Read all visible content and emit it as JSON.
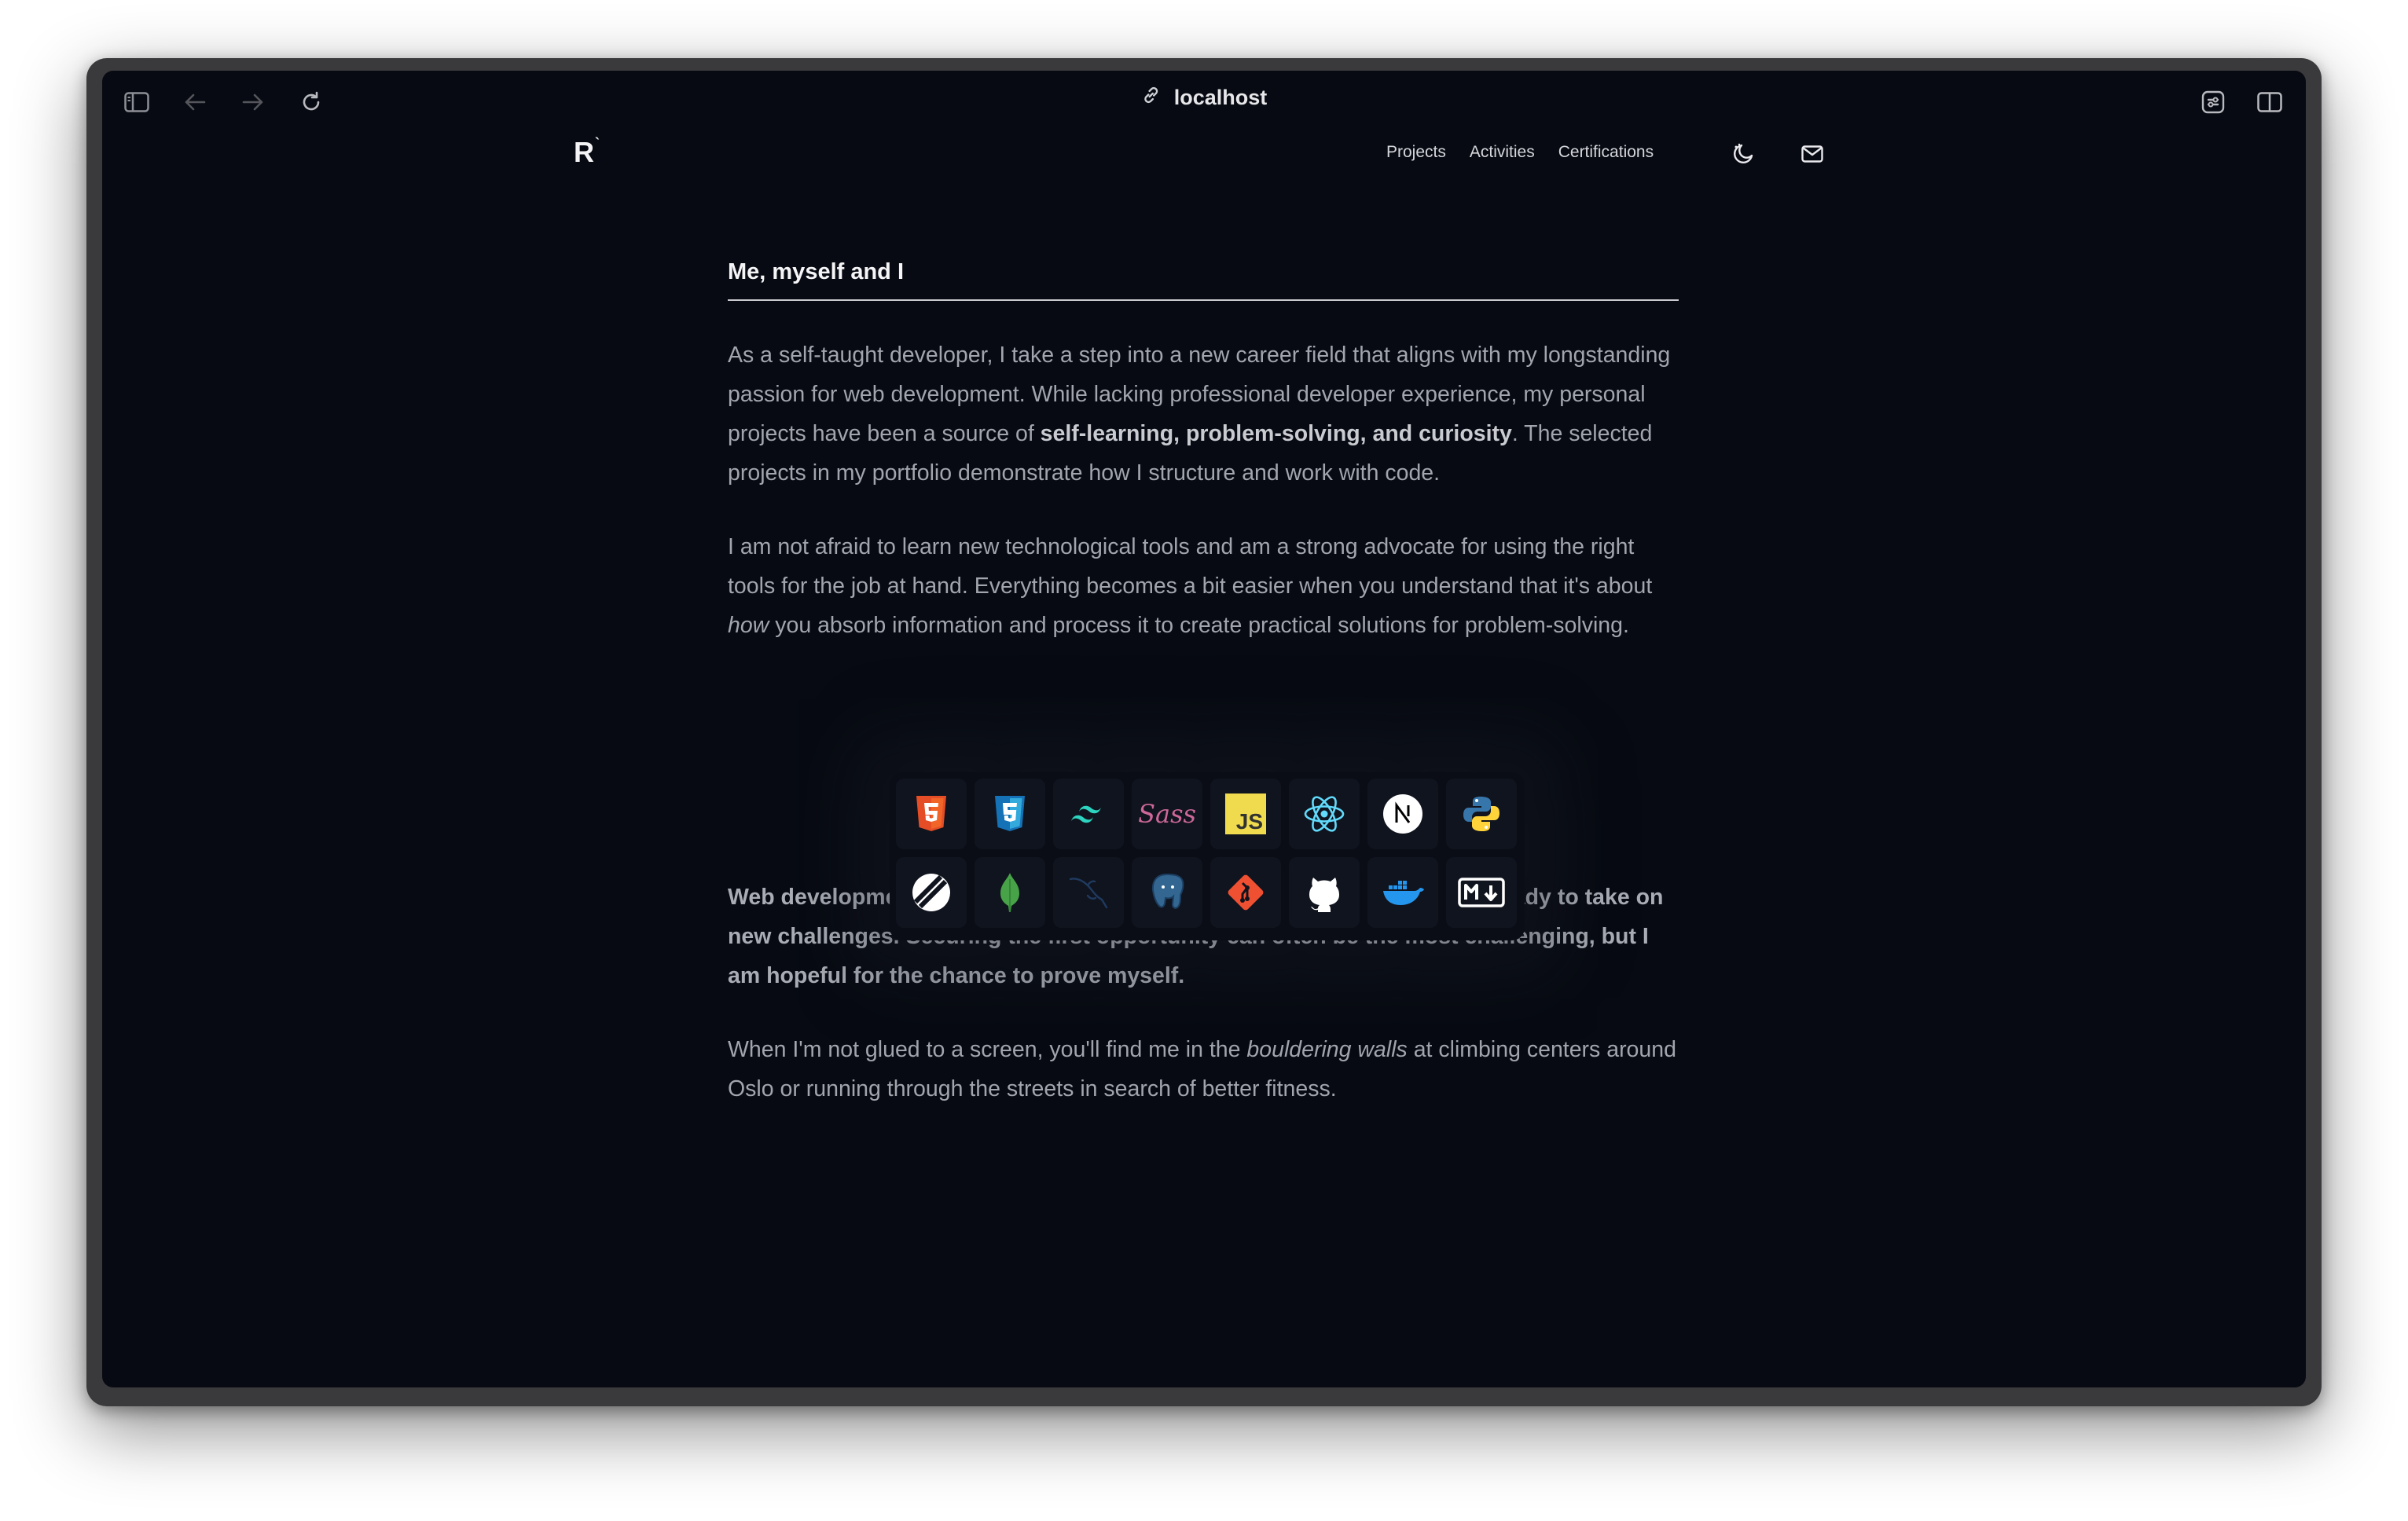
{
  "browser": {
    "url": "localhost",
    "icons": [
      "sidebar-toggle-icon",
      "back-arrow-icon",
      "forward-arrow-icon",
      "reload-icon",
      "link-icon",
      "extensions-icon",
      "split-view-icon"
    ]
  },
  "header": {
    "logo": "R",
    "nav": [
      "Projects",
      "Activities",
      "Certifications"
    ],
    "icons": [
      "theme-toggle-icon",
      "mail-icon"
    ]
  },
  "content": {
    "title": "Me, myself and I",
    "p1": {
      "a": "As a self-taught developer, I take a step into a new career field that aligns with my longstanding passion for web development. While lacking professional developer experience, my personal projects have been a source of ",
      "b": "self-learning, problem-solving, and curiosity",
      "c": ". The selected projects in my portfolio demonstrate how I structure and work with code."
    },
    "p2": {
      "a": "I am not afraid to learn new technological tools and am a strong advocate for using the right tools for the job at hand. Everything becomes a bit easier when you understand that it's about ",
      "em": "how",
      "c": " you absorb information and process it to create practical solutions for problem-solving."
    },
    "p3": "Web development is something I am deeply passionate about, and I am ready to take on new challenges. Securing the first opportunity can often be the most challenging, but I am hopeful for the chance to prove myself.",
    "p4": {
      "a": "When I'm not glued to a screen, you'll find me in the ",
      "em": "bouldering walls",
      "c": " at climbing centers around Oslo or running through the streets in search of better fitness."
    }
  },
  "tech_icons": [
    {
      "name": "html5-icon",
      "color": "#e44d26"
    },
    {
      "name": "css3-icon",
      "color": "#1572b6"
    },
    {
      "name": "tailwind-icon",
      "color": "#38bdf8"
    },
    {
      "name": "sass-icon",
      "color": "#cd6799"
    },
    {
      "name": "javascript-icon",
      "color": "#f0db4f"
    },
    {
      "name": "react-icon",
      "color": "#61dafb"
    },
    {
      "name": "nextjs-icon",
      "color": "#ffffff"
    },
    {
      "name": "python-icon",
      "color": "#3776ab"
    },
    {
      "name": "planetscale-icon",
      "color": "#ffffff"
    },
    {
      "name": "mongodb-icon",
      "color": "#47a248"
    },
    {
      "name": "mysql-icon",
      "color": "#1f3a5f"
    },
    {
      "name": "postgresql-icon",
      "color": "#336791"
    },
    {
      "name": "git-icon",
      "color": "#f05032"
    },
    {
      "name": "github-icon",
      "color": "#ffffff"
    },
    {
      "name": "docker-icon",
      "color": "#2496ed"
    },
    {
      "name": "markdown-icon",
      "color": "#ffffff"
    }
  ]
}
